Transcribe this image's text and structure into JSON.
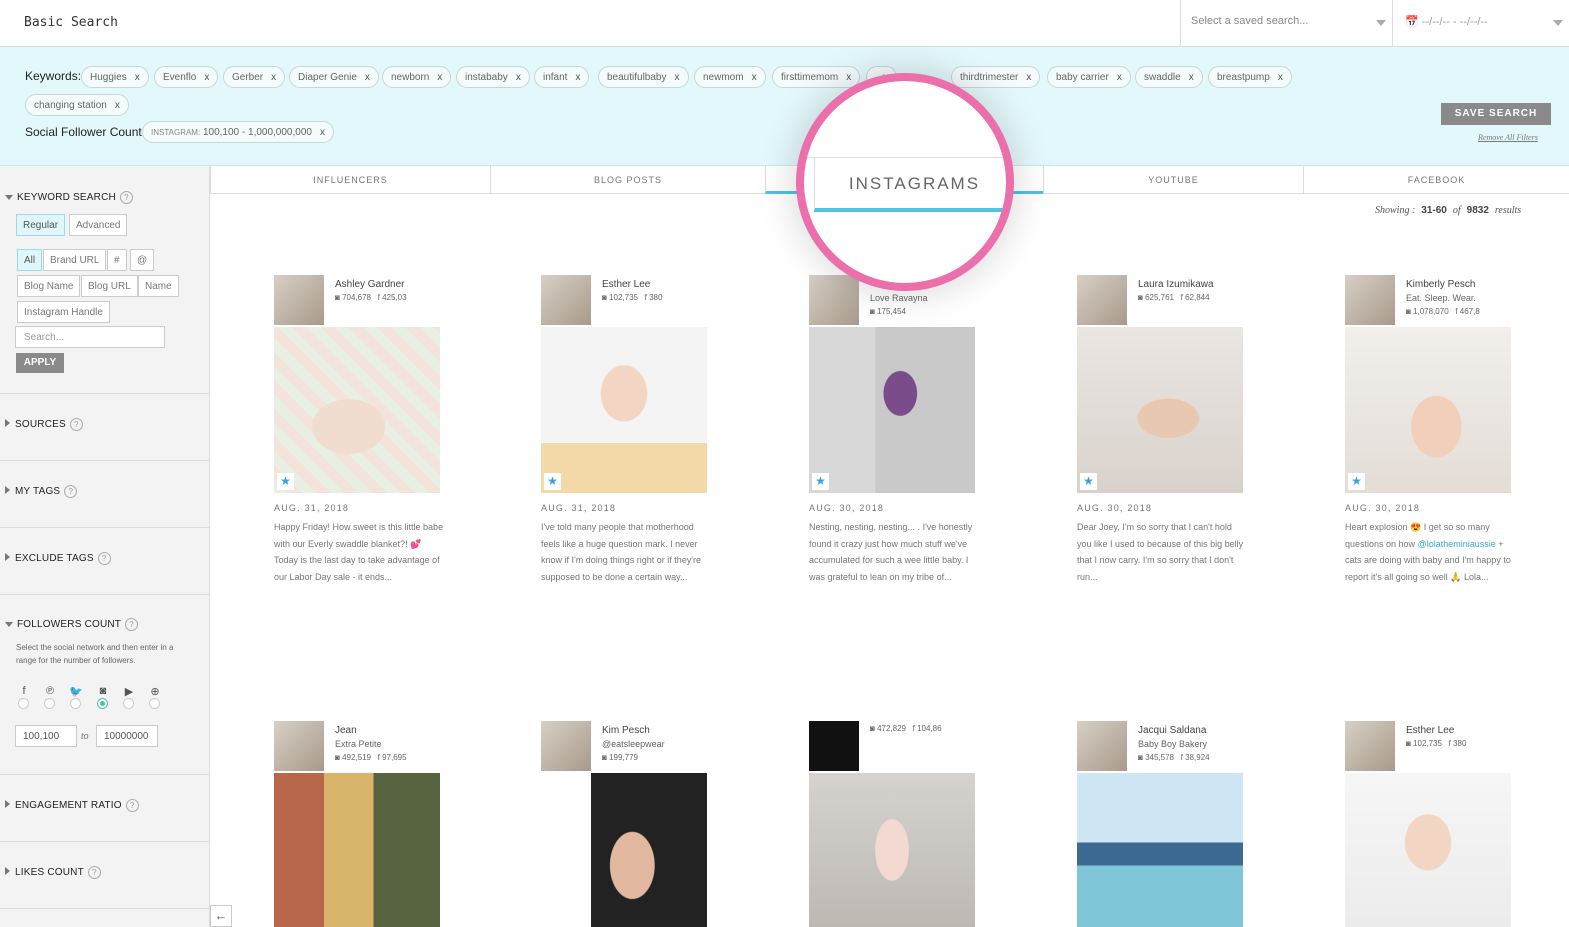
{
  "topbar": {
    "title": "Basic Search",
    "saved_search_placeholder": "Select a saved search...",
    "date_placeholder": "--/--/-- - --/--/--"
  },
  "filters": {
    "keywords_label": "Keywords:",
    "keywords": [
      "Huggies",
      "Evenflo",
      "Gerber",
      "Diaper Genie",
      "newborn",
      "instababy",
      "infant",
      "beautifulbaby",
      "newmom",
      "firsttimemom",
      "",
      "thirdtrimester",
      "baby carrier",
      "swaddle",
      "breastpump",
      "changing station"
    ],
    "chip_remove": "x",
    "follower_label": "Social Follower Count:",
    "follower_chip_network": "INSTAGRAM:",
    "follower_chip_range": "100,100 - 1,000,000,000",
    "save_search": "SAVE SEARCH",
    "remove_all": "Remove All Filters"
  },
  "sidebar": {
    "keyword_search": "KEYWORD SEARCH",
    "help": "?",
    "mode_regular": "Regular",
    "mode_advanced": "Advanced",
    "field_all": "All",
    "field_brand_url": "Brand URL",
    "field_hash": "#",
    "field_at": "@",
    "field_blog_name": "Blog Name",
    "field_blog_url": "Blog URL",
    "field_name": "Name",
    "field_instagram_handle": "Instagram Handle",
    "search_placeholder": "Search...",
    "apply": "APPLY",
    "sources": "SOURCES",
    "my_tags": "MY TAGS",
    "exclude_tags": "EXCLUDE TAGS",
    "followers_count": "FOLLOWERS COUNT",
    "followers_desc": "Select the social network and then enter in a range for the number of followers.",
    "range_from": "100,100",
    "range_to_label": "to",
    "range_to": "10000000",
    "engagement_ratio": "ENGAGEMENT RATIO",
    "likes_count": "LIKES COUNT",
    "networks": [
      {
        "icon": "facebook-icon",
        "glyph": "f"
      },
      {
        "icon": "pinterest-icon",
        "glyph": "℗"
      },
      {
        "icon": "twitter-icon",
        "glyph": "🐦"
      },
      {
        "icon": "instagram-icon",
        "glyph": "◙"
      },
      {
        "icon": "youtube-icon",
        "glyph": "▶"
      },
      {
        "icon": "globe-icon",
        "glyph": "⊕"
      }
    ],
    "selected_network": "instagram"
  },
  "tabs": [
    "INFLUENCERS",
    "BLOG POSTS",
    "INSTAGRAMS",
    "YOUTUBE",
    "FACEBOOK"
  ],
  "active_tab": "INSTAGRAMS",
  "showing": {
    "label": "Showing :",
    "range": "31-60",
    "of": "of",
    "total": "9832",
    "results": "results"
  },
  "posts": [
    {
      "name": "Ashley Gardner",
      "sub": "",
      "stat1": "704,678",
      "stat2": "425,03",
      "date": "AUG. 31, 2018",
      "caption": "Happy Friday! How sweet is this little babe with our Everly swaddle blanket?! 💕 Today is the last day to take advantage of our Labor Day sale - it ends..."
    },
    {
      "name": "Esther Lee",
      "sub": "",
      "stat1": "102,735",
      "stat2": "380",
      "date": "AUG. 31, 2018",
      "caption": "I've told many people that motherhood feels like a huge question mark. I never know if I'm doing things right or if they're supposed to be done a certain way..."
    },
    {
      "name": "",
      "sub": "Love Ravayna",
      "stat1": "175,454",
      "stat2": "",
      "date": "AUG. 30, 2018",
      "caption": "Nesting, nesting, nesting... . I've honestly found it crazy just how much stuff we've accumulated for such a wee little baby. I was grateful to lean on my tribe of..."
    },
    {
      "name": "Laura Izumikawa",
      "sub": "",
      "stat1": "625,761",
      "stat2": "62,844",
      "date": "AUG. 30, 2018",
      "caption": "Dear Joey, I'm so sorry that I can't hold you like I used to because of this big belly that I now carry. I'm so sorry that I don't run..."
    },
    {
      "name": "Kimberly Pesch",
      "sub": "Eat. Sleep. Wear.",
      "stat1": "1,078,070",
      "stat2": "467,8",
      "date": "AUG. 30, 2018",
      "caption_pre": "Heart explosion 😍 I get so so many questions on how ",
      "mention": "@lolatheminiaussie",
      "caption_post": " + cats are doing with baby and I'm happy to report it's all going so well 🙏 Lola..."
    },
    {
      "name": "Jean",
      "sub": "Extra Petite",
      "stat1": "492,519",
      "stat2": "97,695"
    },
    {
      "name": "Kim Pesch",
      "sub": "@eatsleepwear",
      "stat1": "199,779",
      "stat2": ""
    },
    {
      "name": "",
      "sub": "",
      "stat1": "472,829",
      "stat2": "104,86"
    },
    {
      "name": "Jacqui Saldana",
      "sub": "Baby Boy Bakery",
      "stat1": "345,578",
      "stat2": "38,924"
    },
    {
      "name": "Esther Lee",
      "sub": "",
      "stat1": "102,735",
      "stat2": "380"
    }
  ],
  "colors": {
    "accent": "#4fc3e0",
    "filter_bg": "#e3f8fb",
    "magnifier": "#ea6fab",
    "radio_on": "#48c7a8"
  }
}
